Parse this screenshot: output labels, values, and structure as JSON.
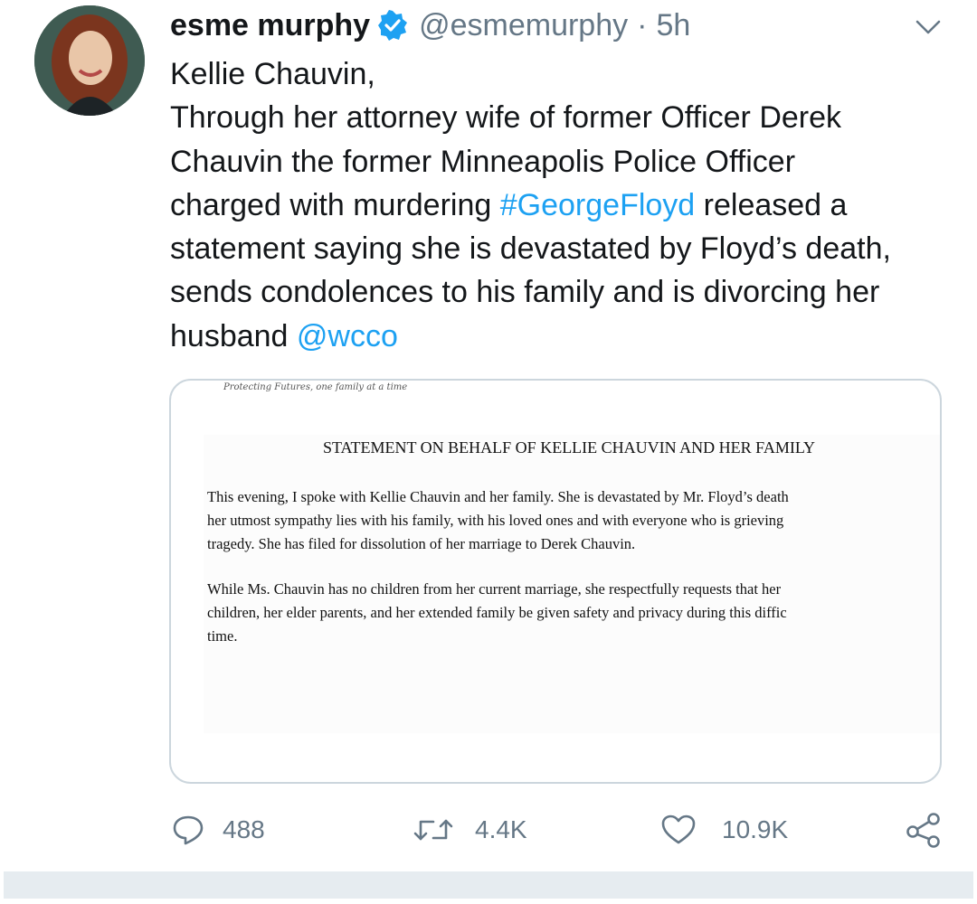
{
  "tweet": {
    "author_name": "esme murphy",
    "handle": "@esmemurphy",
    "dot": "·",
    "time": "5h",
    "text_lines": [
      "Kellie Chauvin,",
      "Through her attorney wife of former Officer Derek",
      "Chauvin the former Minneapolis Police Officer"
    ],
    "line4_pre": "charged with murdering ",
    "hashtag": "#GeorgeFloyd",
    "line4_post": " released a",
    "line5": "statement saying she is devastated by Floyd’s death,",
    "line6": "sends condolences to his family and is divorcing her",
    "line7_pre": "husband ",
    "mention": "@wcco"
  },
  "document": {
    "header": "Protecting Futures, one family at a time",
    "title": "STATEMENT ON BEHALF OF KELLIE CHAUVIN AND HER FAMILY",
    "para1": [
      "This evening, I spoke with Kellie Chauvin and her family. She is devastated by Mr. Floyd’s death",
      "her utmost sympathy lies with his family, with his loved ones and with everyone who is grieving",
      "tragedy. She has filed for dissolution of her marriage to Derek Chauvin."
    ],
    "para2": [
      "While Ms. Chauvin has no children from her current marriage, she respectfully requests that her",
      "children, her elder parents, and her extended family be given safety and privacy during this diffic",
      "time."
    ]
  },
  "actions": {
    "replies": "488",
    "retweets": "4.4K",
    "likes": "10.9K"
  },
  "colors": {
    "link": "#1da1f2",
    "muted": "#657786",
    "verified": "#1da1f2"
  },
  "icons": [
    "verified-badge-icon",
    "chevron-down-icon",
    "reply-icon",
    "retweet-icon",
    "like-icon",
    "share-icon"
  ]
}
